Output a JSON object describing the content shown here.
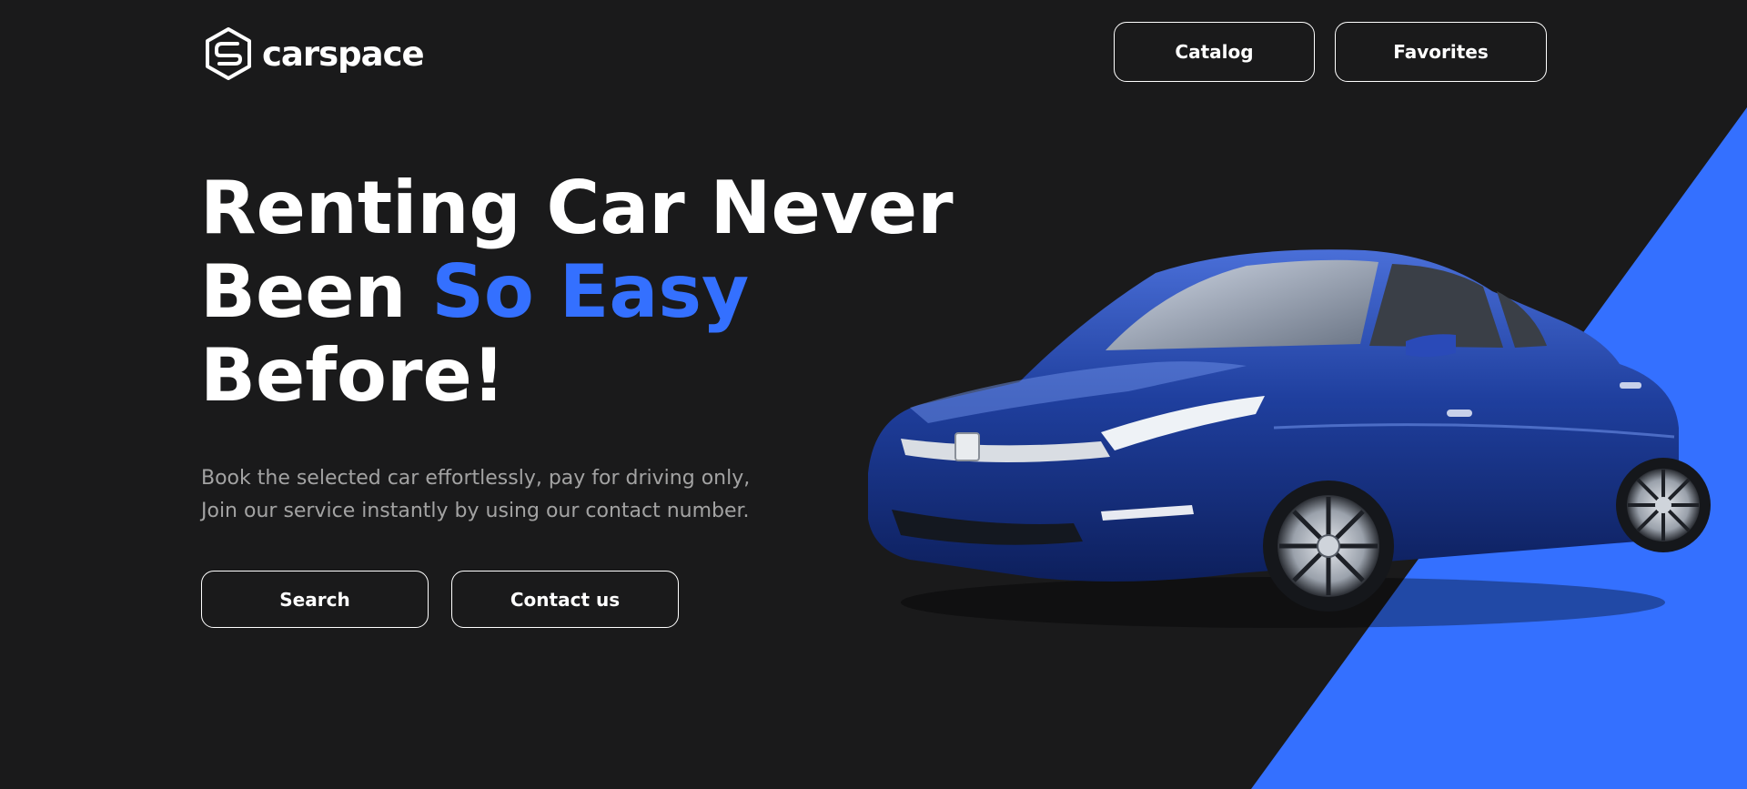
{
  "brand": {
    "name": "carspace",
    "logo_icon": "carspace-logo-icon"
  },
  "nav": {
    "catalog_label": "Catalog",
    "favorites_label": "Favorites"
  },
  "hero": {
    "title_line1": "Renting Car Never",
    "title_line2_plain": "Been",
    "title_line2_accent": "So Easy",
    "title_line3": "Before!",
    "subtitle_line1": "Book the selected car effortlessly, pay for driving only,",
    "subtitle_line2": "Join our service instantly by using our contact number.",
    "search_label": "Search",
    "contact_label": "Contact us",
    "image": "blue-sedan-car-image"
  },
  "colors": {
    "background": "#1a1a1b",
    "accent": "#3470ff",
    "text": "#ffffff",
    "muted_text": "#a3a3a3"
  }
}
